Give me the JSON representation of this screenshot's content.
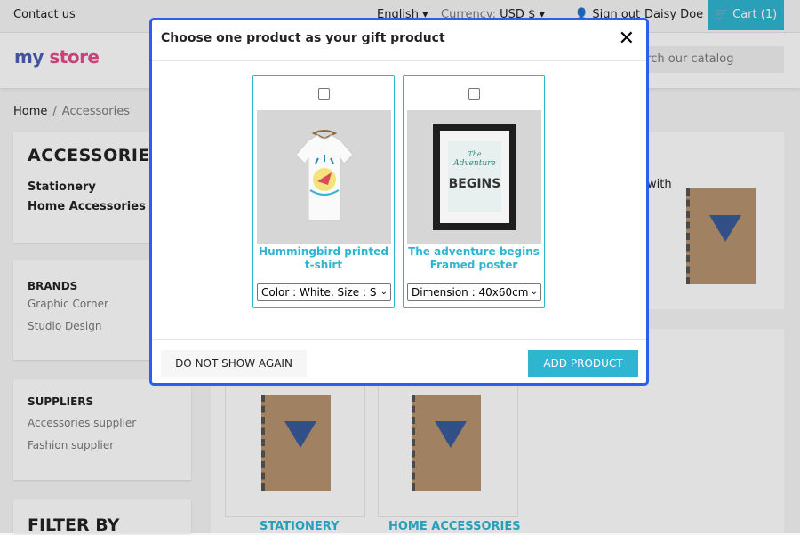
{
  "topbar": {
    "contact": "Contact us",
    "language": "English",
    "currency_label": "Currency:",
    "currency_value": "USD $",
    "sign_out": "Sign out",
    "user": "Daisy Doe",
    "cart_label": "Cart",
    "cart_count": "(1)"
  },
  "header": {
    "logo_my": "my",
    "logo_store": "store",
    "search_placeholder": "Search our catalog"
  },
  "breadcrumb": {
    "home": "Home",
    "current": "Accessories"
  },
  "sidebar": {
    "category_title": "ACCESSORIES",
    "categories": [
      "Stationery",
      "Home Accessories"
    ],
    "brands_title": "BRANDS",
    "brands": [
      "Graphic Corner",
      "Studio Design"
    ],
    "suppliers_title": "SUPPLIERS",
    "suppliers": [
      "Accessories supplier",
      "Fashion supplier"
    ],
    "filter_title": "FILTER BY"
  },
  "content": {
    "desc_fragment": "with",
    "categories": [
      "STATIONERY",
      "HOME ACCESSORIES"
    ]
  },
  "modal": {
    "title": "Choose one product as your gift product",
    "products": [
      {
        "name": "Hummingbird printed t-shirt",
        "option": "Color : White, Size : S"
      },
      {
        "name": "The adventure begins Framed poster",
        "option": "Dimension : 40x60cm"
      }
    ],
    "dont_show_label": "DO NOT SHOW AGAIN",
    "add_label": "ADD PRODUCT",
    "poster_text": [
      "The",
      "Adventure",
      "BEGINS"
    ]
  },
  "colors": {
    "accent": "#2fb5d2",
    "modal_border": "#2b5fec"
  }
}
